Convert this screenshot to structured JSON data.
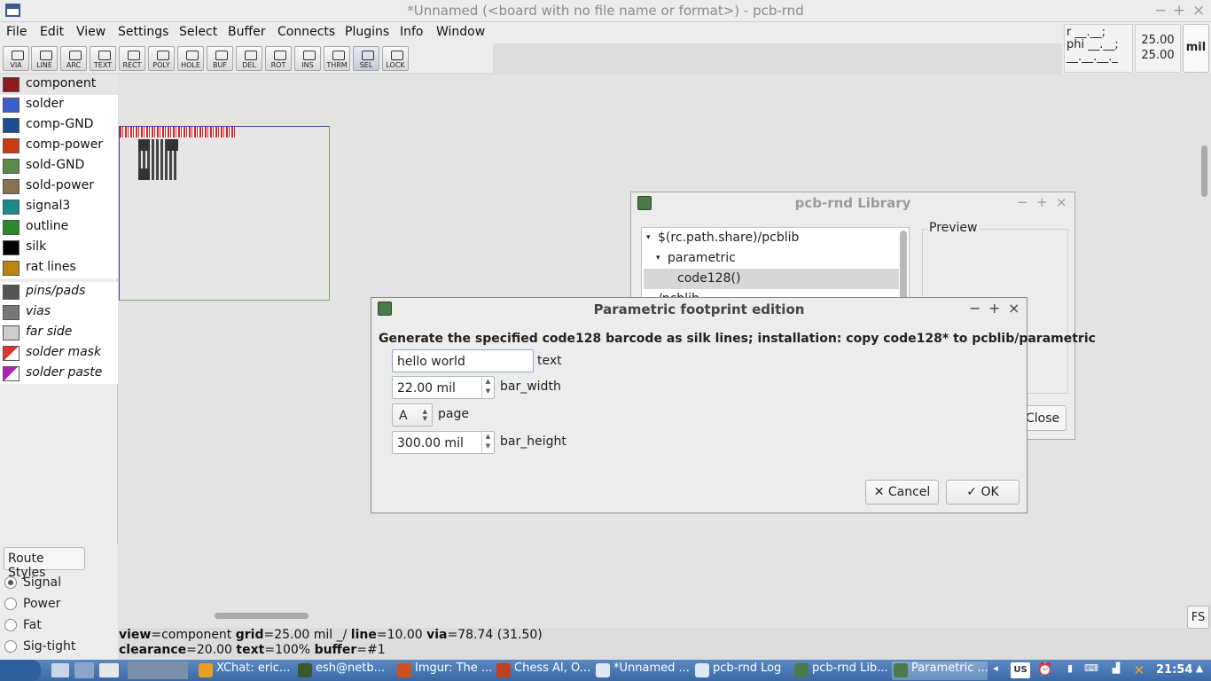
{
  "app": {
    "title": "*Unnamed (<board with no file name or format>) - pcb-rnd",
    "window_controls": [
      "−",
      "+",
      "×"
    ]
  },
  "menu": [
    "File",
    "Edit",
    "View",
    "Settings",
    "Select",
    "Buffer",
    "Connects",
    "Plugins",
    "Info",
    "Window"
  ],
  "tools": [
    "VIA",
    "LINE",
    "ARC",
    "TEXT",
    "RECT",
    "POLY",
    "HOLE",
    "BUF",
    "DEL",
    "ROT",
    "INS",
    "THRM",
    "SEL",
    "LOCK"
  ],
  "coords": {
    "r": "r __.__;",
    "phi": "phi __.__;",
    "rest": "__.__.__._ __",
    "x": "25.00",
    "y": "25.00",
    "units": "mil"
  },
  "layers": [
    {
      "name": "component",
      "color": "#8c1c1c"
    },
    {
      "name": "solder",
      "color": "#3a5fcd"
    },
    {
      "name": "comp-GND",
      "color": "#1a4f8f"
    },
    {
      "name": "comp-power",
      "color": "#d03a10"
    },
    {
      "name": "sold-GND",
      "color": "#5a8a4a"
    },
    {
      "name": "sold-power",
      "color": "#8a7050"
    },
    {
      "name": "signal3",
      "color": "#1a8a8a"
    },
    {
      "name": "outline",
      "color": "#2a8a2a"
    },
    {
      "name": "silk",
      "color": "#000000"
    },
    {
      "name": "rat lines",
      "color": "#b8860b"
    }
  ],
  "special_layers": [
    {
      "name": "pins/pads",
      "color": "#555555"
    },
    {
      "name": "vias",
      "color": "#777777"
    },
    {
      "name": "far side",
      "color": "#cccccc"
    },
    {
      "name": "solder mask",
      "color": "#e03030"
    },
    {
      "name": "solder paste",
      "color": "#b020b0"
    }
  ],
  "route": {
    "button": "Route Styles",
    "styles": [
      "Signal",
      "Power",
      "Fat",
      "Sig-tight"
    ],
    "selected": "Signal"
  },
  "fs_label": "FS",
  "status": {
    "view_k": "view",
    "view_v": "=component",
    "grid_k": "grid",
    "grid_v": "=25.00 mil  _/",
    "line_k": "line",
    "line_v": "=10.00",
    "via_k": "via",
    "via_v": "=78.74 (31.50)",
    "clear_k": "clearance",
    "clear_v": "=20.00",
    "text_k": "text",
    "text_v": "=100%",
    "buffer_k": "buffer",
    "buffer_v": "=#1"
  },
  "library": {
    "title": "pcb-rnd Library",
    "tree": [
      "$(rc.path.share)/pcblib",
      "parametric",
      "code128()",
      "/pcblib"
    ],
    "preview": "Preview",
    "close": "Close"
  },
  "param": {
    "title": "Parametric footprint edition",
    "description": "Generate the specified code128 barcode as silk lines; installation: copy code128* to pcblib/parametric",
    "text_value": "hello world",
    "text_label": "text",
    "bar_width_value": "22.00 mil",
    "bar_width_label": "bar_width",
    "page_value": "A",
    "page_label": "page",
    "bar_height_value": "300.00 mil",
    "bar_height_label": "bar_height",
    "cancel": "Cancel",
    "ok": "OK"
  },
  "taskbar": {
    "tasks": [
      "XChat: eric...",
      "esh@netb...",
      "Imgur: The ...",
      "Chess AI, O...",
      "*Unnamed ...",
      "pcb-rnd Log",
      "pcb-rnd Lib...",
      "Parametric ..."
    ],
    "layout": "US",
    "clock": "21:54"
  }
}
